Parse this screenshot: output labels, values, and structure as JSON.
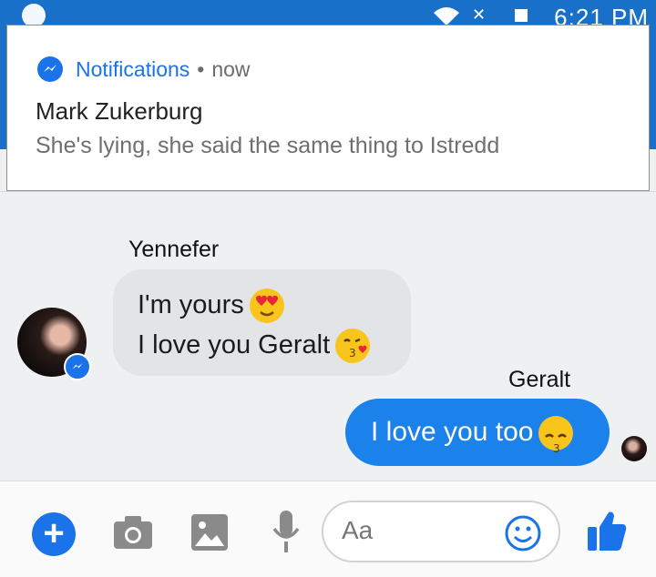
{
  "status_bar": {
    "time": "6:21 PM"
  },
  "notification": {
    "app_name": "Notifications",
    "separator": "•",
    "time": "now",
    "sender": "Mark Zukerburg",
    "text": "She's lying, she said the same thing to Istredd"
  },
  "chat": {
    "incoming_name": "Yennefer",
    "incoming_lines": [
      "I'm yours",
      "I love you Geralt"
    ],
    "outgoing_name": "Geralt",
    "outgoing_text": "I love you too"
  },
  "composer": {
    "placeholder": "Aa"
  },
  "colors": {
    "accent": "#1a73e8",
    "outgoing_bubble": "#1a82ea",
    "incoming_bubble": "#e3e4e8"
  }
}
